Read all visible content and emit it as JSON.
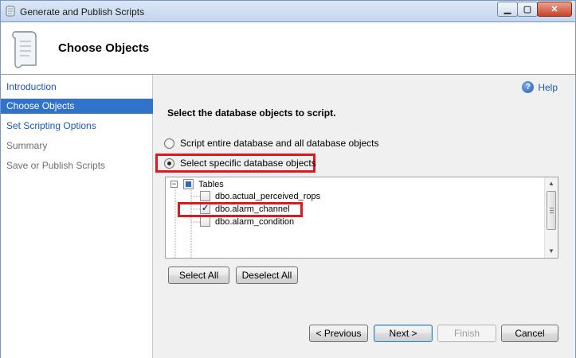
{
  "window": {
    "title": "Generate and Publish Scripts"
  },
  "header": {
    "title": "Choose Objects"
  },
  "nav": {
    "items": [
      {
        "label": "Introduction",
        "state": "link"
      },
      {
        "label": "Choose Objects",
        "state": "active"
      },
      {
        "label": "Set Scripting Options",
        "state": "link"
      },
      {
        "label": "Summary",
        "state": "disabled"
      },
      {
        "label": "Save or Publish Scripts",
        "state": "disabled"
      }
    ]
  },
  "help": {
    "label": "Help"
  },
  "main": {
    "heading": "Select the database objects to script.",
    "radio_entire": "Script entire database and all database objects",
    "radio_specific": "Select specific database objects",
    "selected_radio": "specific",
    "tree": {
      "root": {
        "label": "Tables",
        "state": "partial"
      },
      "children": [
        {
          "label": "dbo.actual_perceived_rops",
          "checked": false
        },
        {
          "label": "dbo.alarm_channel",
          "checked": true
        },
        {
          "label": "dbo.alarm_condition",
          "checked": false
        }
      ]
    },
    "select_all": "Select All",
    "deselect_all": "Deselect All"
  },
  "footer": {
    "previous": "< Previous",
    "next": "Next >",
    "finish": "Finish",
    "cancel": "Cancel"
  },
  "colors": {
    "highlight": "#e0171f",
    "nav_active": "#3173c8",
    "link": "#1a56b8"
  }
}
